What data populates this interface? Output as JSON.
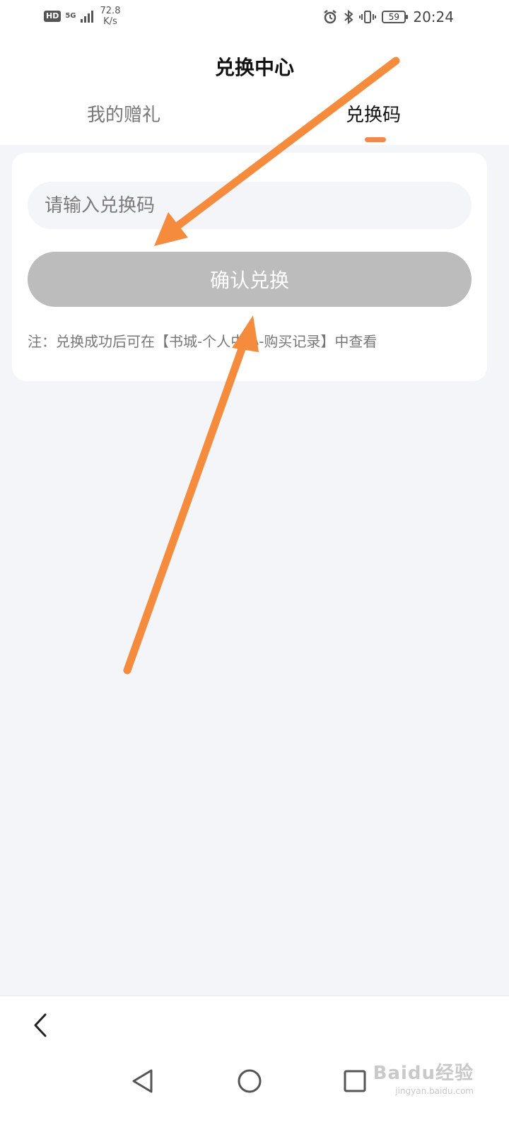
{
  "status_bar": {
    "hd": "HD",
    "network": "5G",
    "speed_value": "72.8",
    "speed_unit": "K/s",
    "battery": "59",
    "time": "20:24"
  },
  "header": {
    "title": "兑换中心",
    "tabs": [
      {
        "label": "我的赠礼",
        "active": false
      },
      {
        "label": "兑换码",
        "active": true
      }
    ]
  },
  "redeem": {
    "placeholder": "请输入兑换码",
    "value": "",
    "confirm_label": "确认兑换",
    "note": "注：兑换成功后可在【书城-个人中心-购买记录】中查看"
  },
  "watermark": {
    "logo": "Baidu经验",
    "url": "jingyan.baidu.com"
  },
  "colors": {
    "accent": "#f4874b",
    "button_disabled": "#bcbcbc",
    "page_background": "#f4f5f9",
    "annotation_arrow": "#f58b3c"
  }
}
